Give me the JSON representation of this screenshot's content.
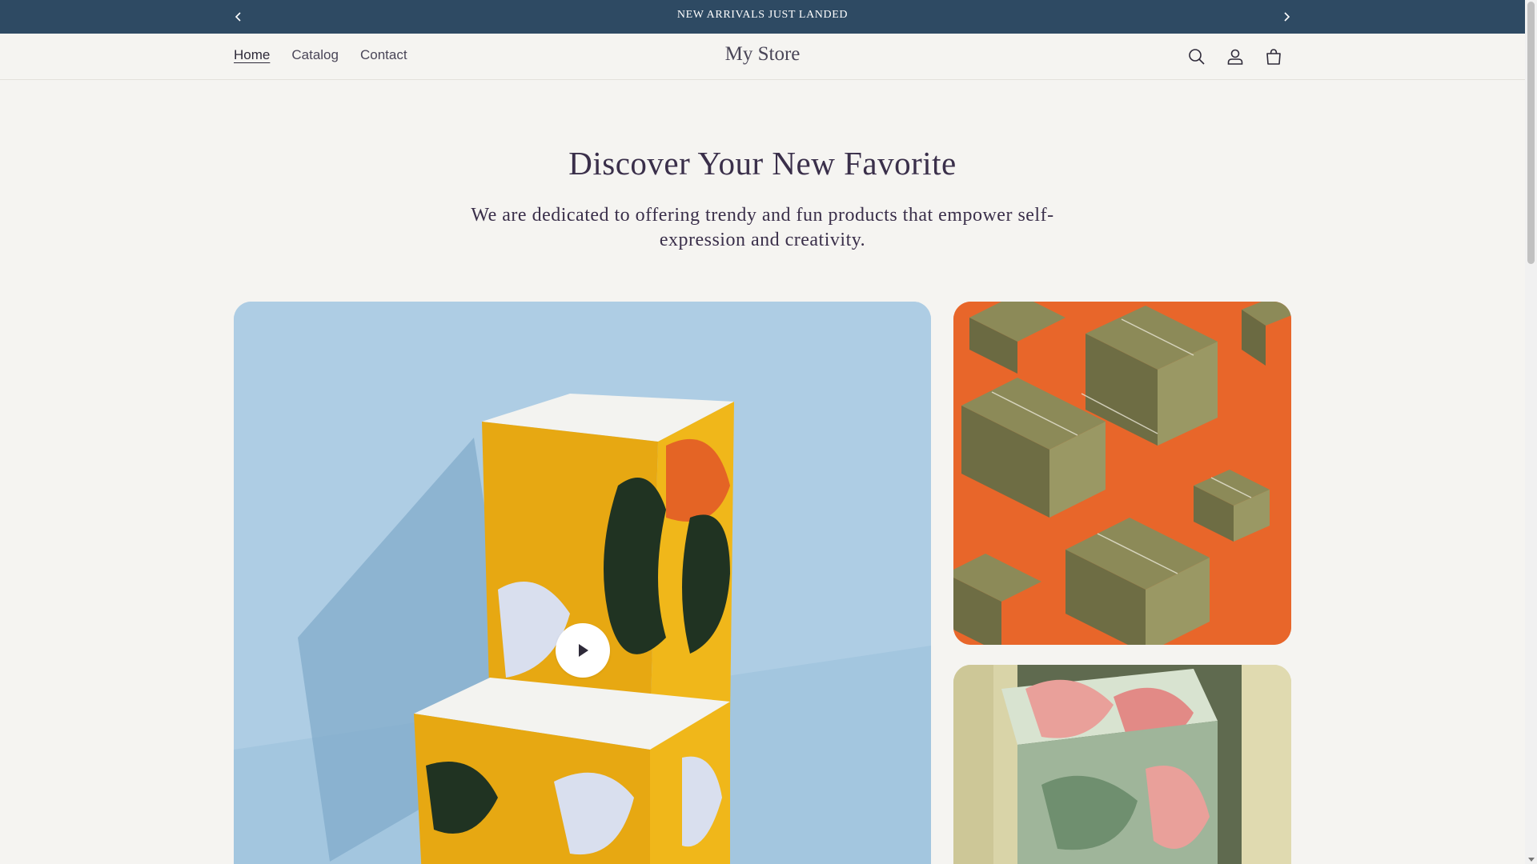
{
  "announcement": {
    "text": "NEW ARRIVALS JUST LANDED",
    "prev_icon": "chevron-left-icon",
    "next_icon": "chevron-right-icon"
  },
  "header": {
    "store_name": "My Store",
    "nav": [
      {
        "label": "Home",
        "active": true
      },
      {
        "label": "Catalog",
        "active": false
      },
      {
        "label": "Contact",
        "active": false
      }
    ],
    "icons": [
      "search-icon",
      "account-icon",
      "cart-icon"
    ]
  },
  "hero": {
    "title": "Discover Your New Favorite",
    "subtitle": "We are dedicated to offering trendy and fun products that empower self-expression and creativity."
  },
  "colors": {
    "announcement_bg": "#2e4a63",
    "page_bg": "#f5f4f1",
    "heading": "#3a2f4a"
  }
}
